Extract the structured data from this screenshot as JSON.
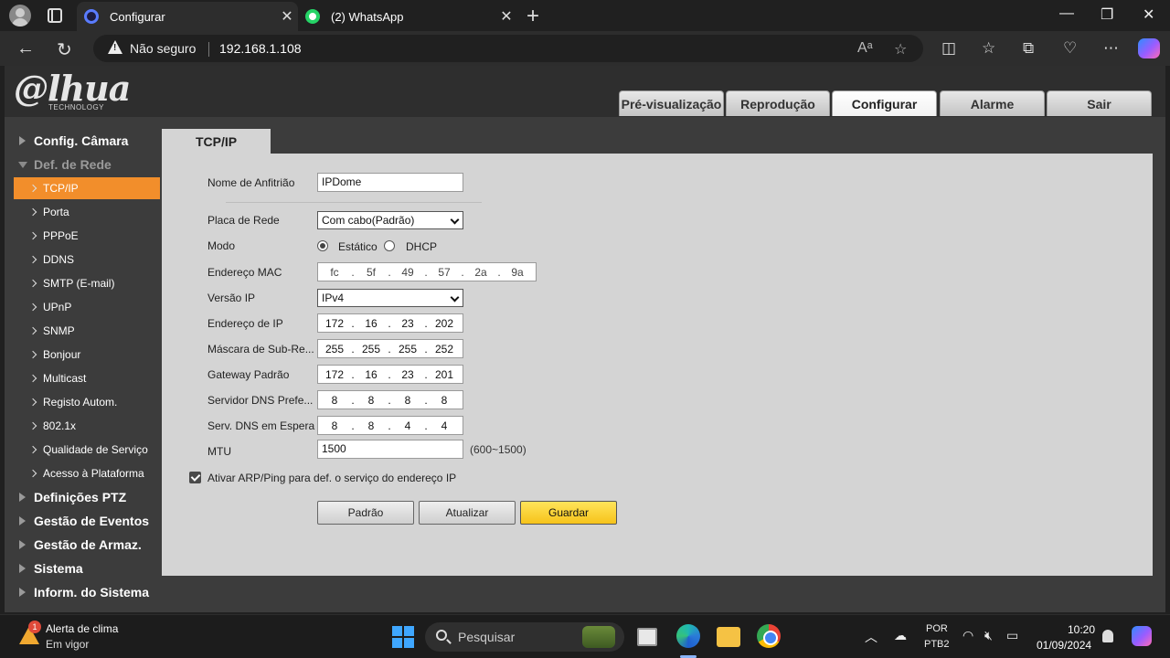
{
  "browser": {
    "tabs": [
      {
        "label": "Configurar"
      },
      {
        "label": "(2) WhatsApp"
      }
    ],
    "address": {
      "security": "Não seguro",
      "url": "192.168.1.108"
    },
    "icons": {
      "back": "arrow-left-icon",
      "reload": "reload-icon",
      "read_aloud": "read-aloud-icon",
      "favorite": "star-icon",
      "split": "split-screen-icon",
      "favorites": "favorites-icon",
      "collections": "collections-icon",
      "performance": "heartbeat-icon",
      "more": "more-icon"
    }
  },
  "dahua": {
    "logo": "@lhua",
    "logo_sub": "TECHNOLOGY",
    "nav": [
      "Pré-visualização",
      "Reprodução",
      "Configurar",
      "Alarme",
      "Sair"
    ],
    "active_nav": "Configurar",
    "sidebar": {
      "sections_top": [
        "Config. Câmara",
        "Def. de Rede"
      ],
      "network_items": [
        "TCP/IP",
        "Porta",
        "PPPoE",
        "DDNS",
        "SMTP (E-mail)",
        "UPnP",
        "SNMP",
        "Bonjour",
        "Multicast",
        "Registo Autom.",
        "802.1x",
        "Qualidade de Serviço",
        "Acesso à Plataforma"
      ],
      "sections_bottom": [
        "Definições PTZ",
        "Gestão de Eventos",
        "Gestão de Armaz.",
        "Sistema",
        "Inform. do Sistema"
      ]
    },
    "content_tab": "TCP/IP",
    "form": {
      "hostname_label": "Nome de Anfitrião",
      "hostname_value": "IPDome",
      "nic_label": "Placa de Rede",
      "nic_value": "Com cabo(Padrão)",
      "mode_label": "Modo",
      "mode_static": "Estático",
      "mode_dhcp": "DHCP",
      "mode_selected": "Estático",
      "mac_label": "Endereço MAC",
      "mac": [
        "fc",
        "5f",
        "49",
        "57",
        "2a",
        "9a"
      ],
      "ipver_label": "Versão IP",
      "ipver_value": "IPv4",
      "ip_label": "Endereço de IP",
      "ip": [
        "172",
        "16",
        "23",
        "202"
      ],
      "mask_label": "Máscara de Sub-Re...",
      "mask": [
        "255",
        "255",
        "255",
        "252"
      ],
      "gw_label": "Gateway Padrão",
      "gw": [
        "172",
        "16",
        "23",
        "201"
      ],
      "dns1_label": "Servidor DNS Prefe...",
      "dns1": [
        "8",
        "8",
        "8",
        "8"
      ],
      "dns2_label": "Serv. DNS em Espera",
      "dns2": [
        "8",
        "8",
        "4",
        "4"
      ],
      "mtu_label": "MTU",
      "mtu_value": "1500",
      "mtu_hint": "(600~1500)",
      "arp_label": "Ativar ARP/Ping para def. o serviço do endereço IP",
      "arp_checked": true
    },
    "buttons": {
      "default": "Padrão",
      "refresh": "Atualizar",
      "save": "Guardar"
    },
    "colors": {
      "active_item": "#f28e2b",
      "save_button": "#f6c31a",
      "content_bg": "#d4d4d4"
    }
  },
  "taskbar": {
    "weather_title": "Alerta de clima",
    "weather_sub": "Em vigor",
    "weather_badge": "1",
    "search_placeholder": "Pesquisar",
    "lang_1": "POR",
    "lang_2": "PTB2",
    "time": "10:20",
    "date": "01/09/2024"
  }
}
